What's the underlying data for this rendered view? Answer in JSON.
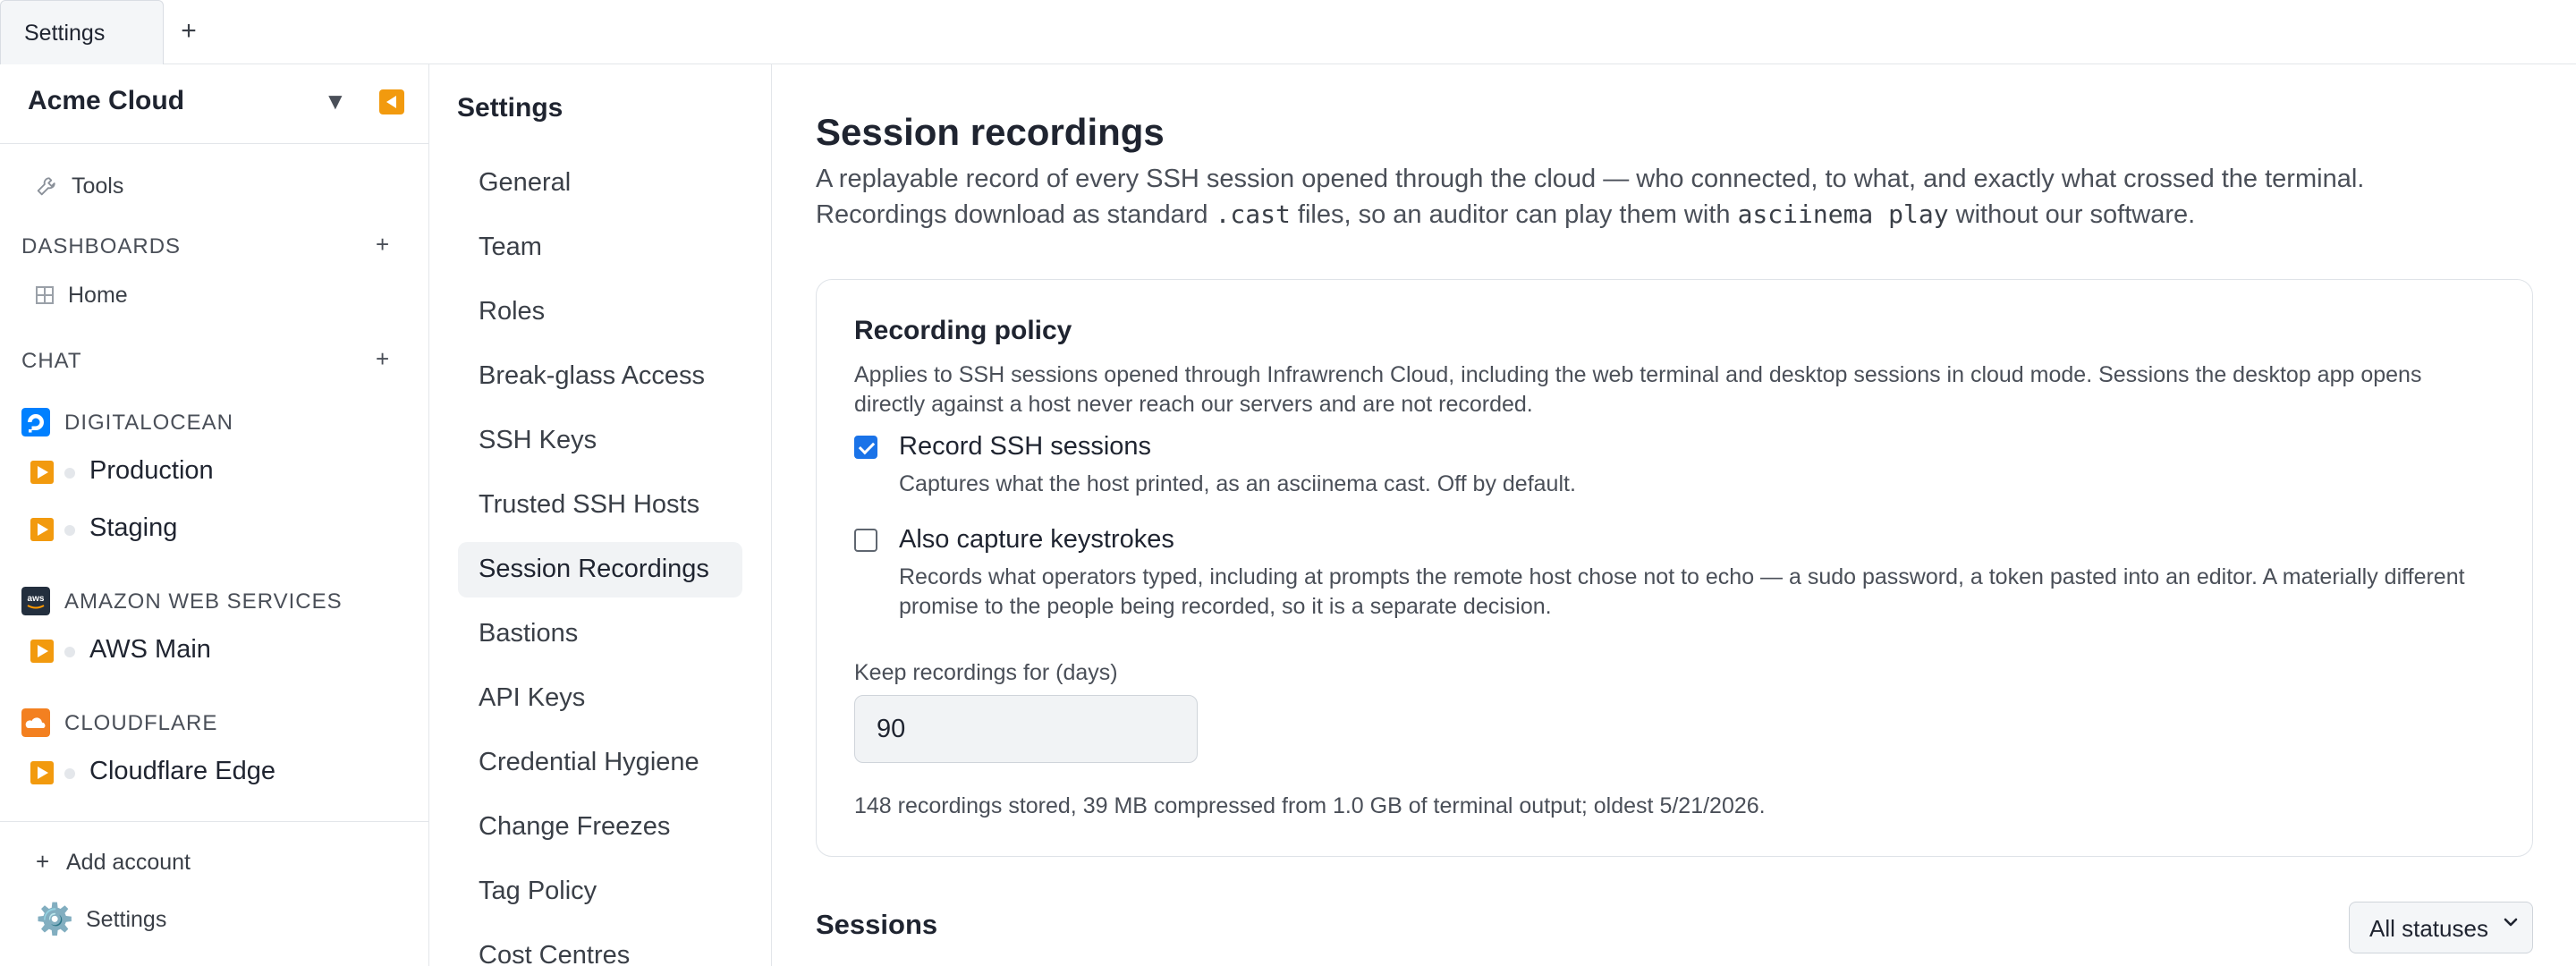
{
  "tabs": [
    {
      "label": "Settings"
    }
  ],
  "tab_add_label": "+",
  "sidebar": {
    "account_name": "Acme Cloud",
    "caret": "▼",
    "tools_label": "Tools",
    "dashboards_heading": "DASHBOARDS",
    "dashboards_add": "+",
    "home_label": "Home",
    "chat_heading": "CHAT",
    "chat_add": "+",
    "providers": [
      {
        "name": "DIGITALOCEAN",
        "icon": "digitalocean-icon",
        "color": "#0080ff",
        "connections": [
          "Production",
          "Staging"
        ]
      },
      {
        "name": "AMAZON WEB SERVICES",
        "icon": "aws-icon",
        "color": "#232f3e",
        "connections": [
          "AWS Main"
        ]
      },
      {
        "name": "CLOUDFLARE",
        "icon": "cloudflare-icon",
        "color": "#f38020",
        "connections": [
          "Cloudflare Edge"
        ]
      }
    ],
    "add_account_plus": "+",
    "add_account_label": "Add account",
    "settings_icon": "⚙️",
    "settings_label": "Settings"
  },
  "settings_nav": {
    "title": "Settings",
    "items": [
      "General",
      "Team",
      "Roles",
      "Break-glass Access",
      "SSH Keys",
      "Trusted SSH Hosts",
      "Session Recordings",
      "Bastions",
      "API Keys",
      "Credential Hygiene",
      "Change Freezes",
      "Tag Policy",
      "Cost Centres"
    ],
    "active": "Session Recordings"
  },
  "main": {
    "title": "Session recordings",
    "desc_part1": "A replayable record of every SSH session opened through the cloud — who connected, to what, and exactly what crossed the terminal. Recordings download as standard ",
    "desc_code1": ".cast",
    "desc_part2": " files, so an auditor can play them with ",
    "desc_code2": "asciinema play",
    "desc_part3": " without our software.",
    "policy": {
      "title": "Recording policy",
      "description": "Applies to SSH sessions opened through Infrawrench Cloud, including the web terminal and desktop sessions in cloud mode. Sessions the desktop app opens directly against a host never reach our servers and are not recorded.",
      "record_label": "Record SSH sessions",
      "record_checked": true,
      "record_help": "Captures what the host printed, as an asciinema cast. Off by default.",
      "keystrokes_label": "Also capture keystrokes",
      "keystrokes_checked": false,
      "keystrokes_help": "Records what operators typed, including at prompts the remote host chose not to echo — a sudo password, a token pasted into an editor. A materially different promise to the people being recorded, so it is a separate decision.",
      "retention_label": "Keep recordings for (days)",
      "retention_value": "90",
      "stats": "148 recordings stored, 39 MB compressed from 1.0 GB of terminal output; oldest 5/21/2026."
    },
    "sessions_title": "Sessions",
    "status_filter": "All statuses"
  },
  "colors": {
    "accent": "#f29a0e",
    "checkbox": "#1a73e8"
  }
}
